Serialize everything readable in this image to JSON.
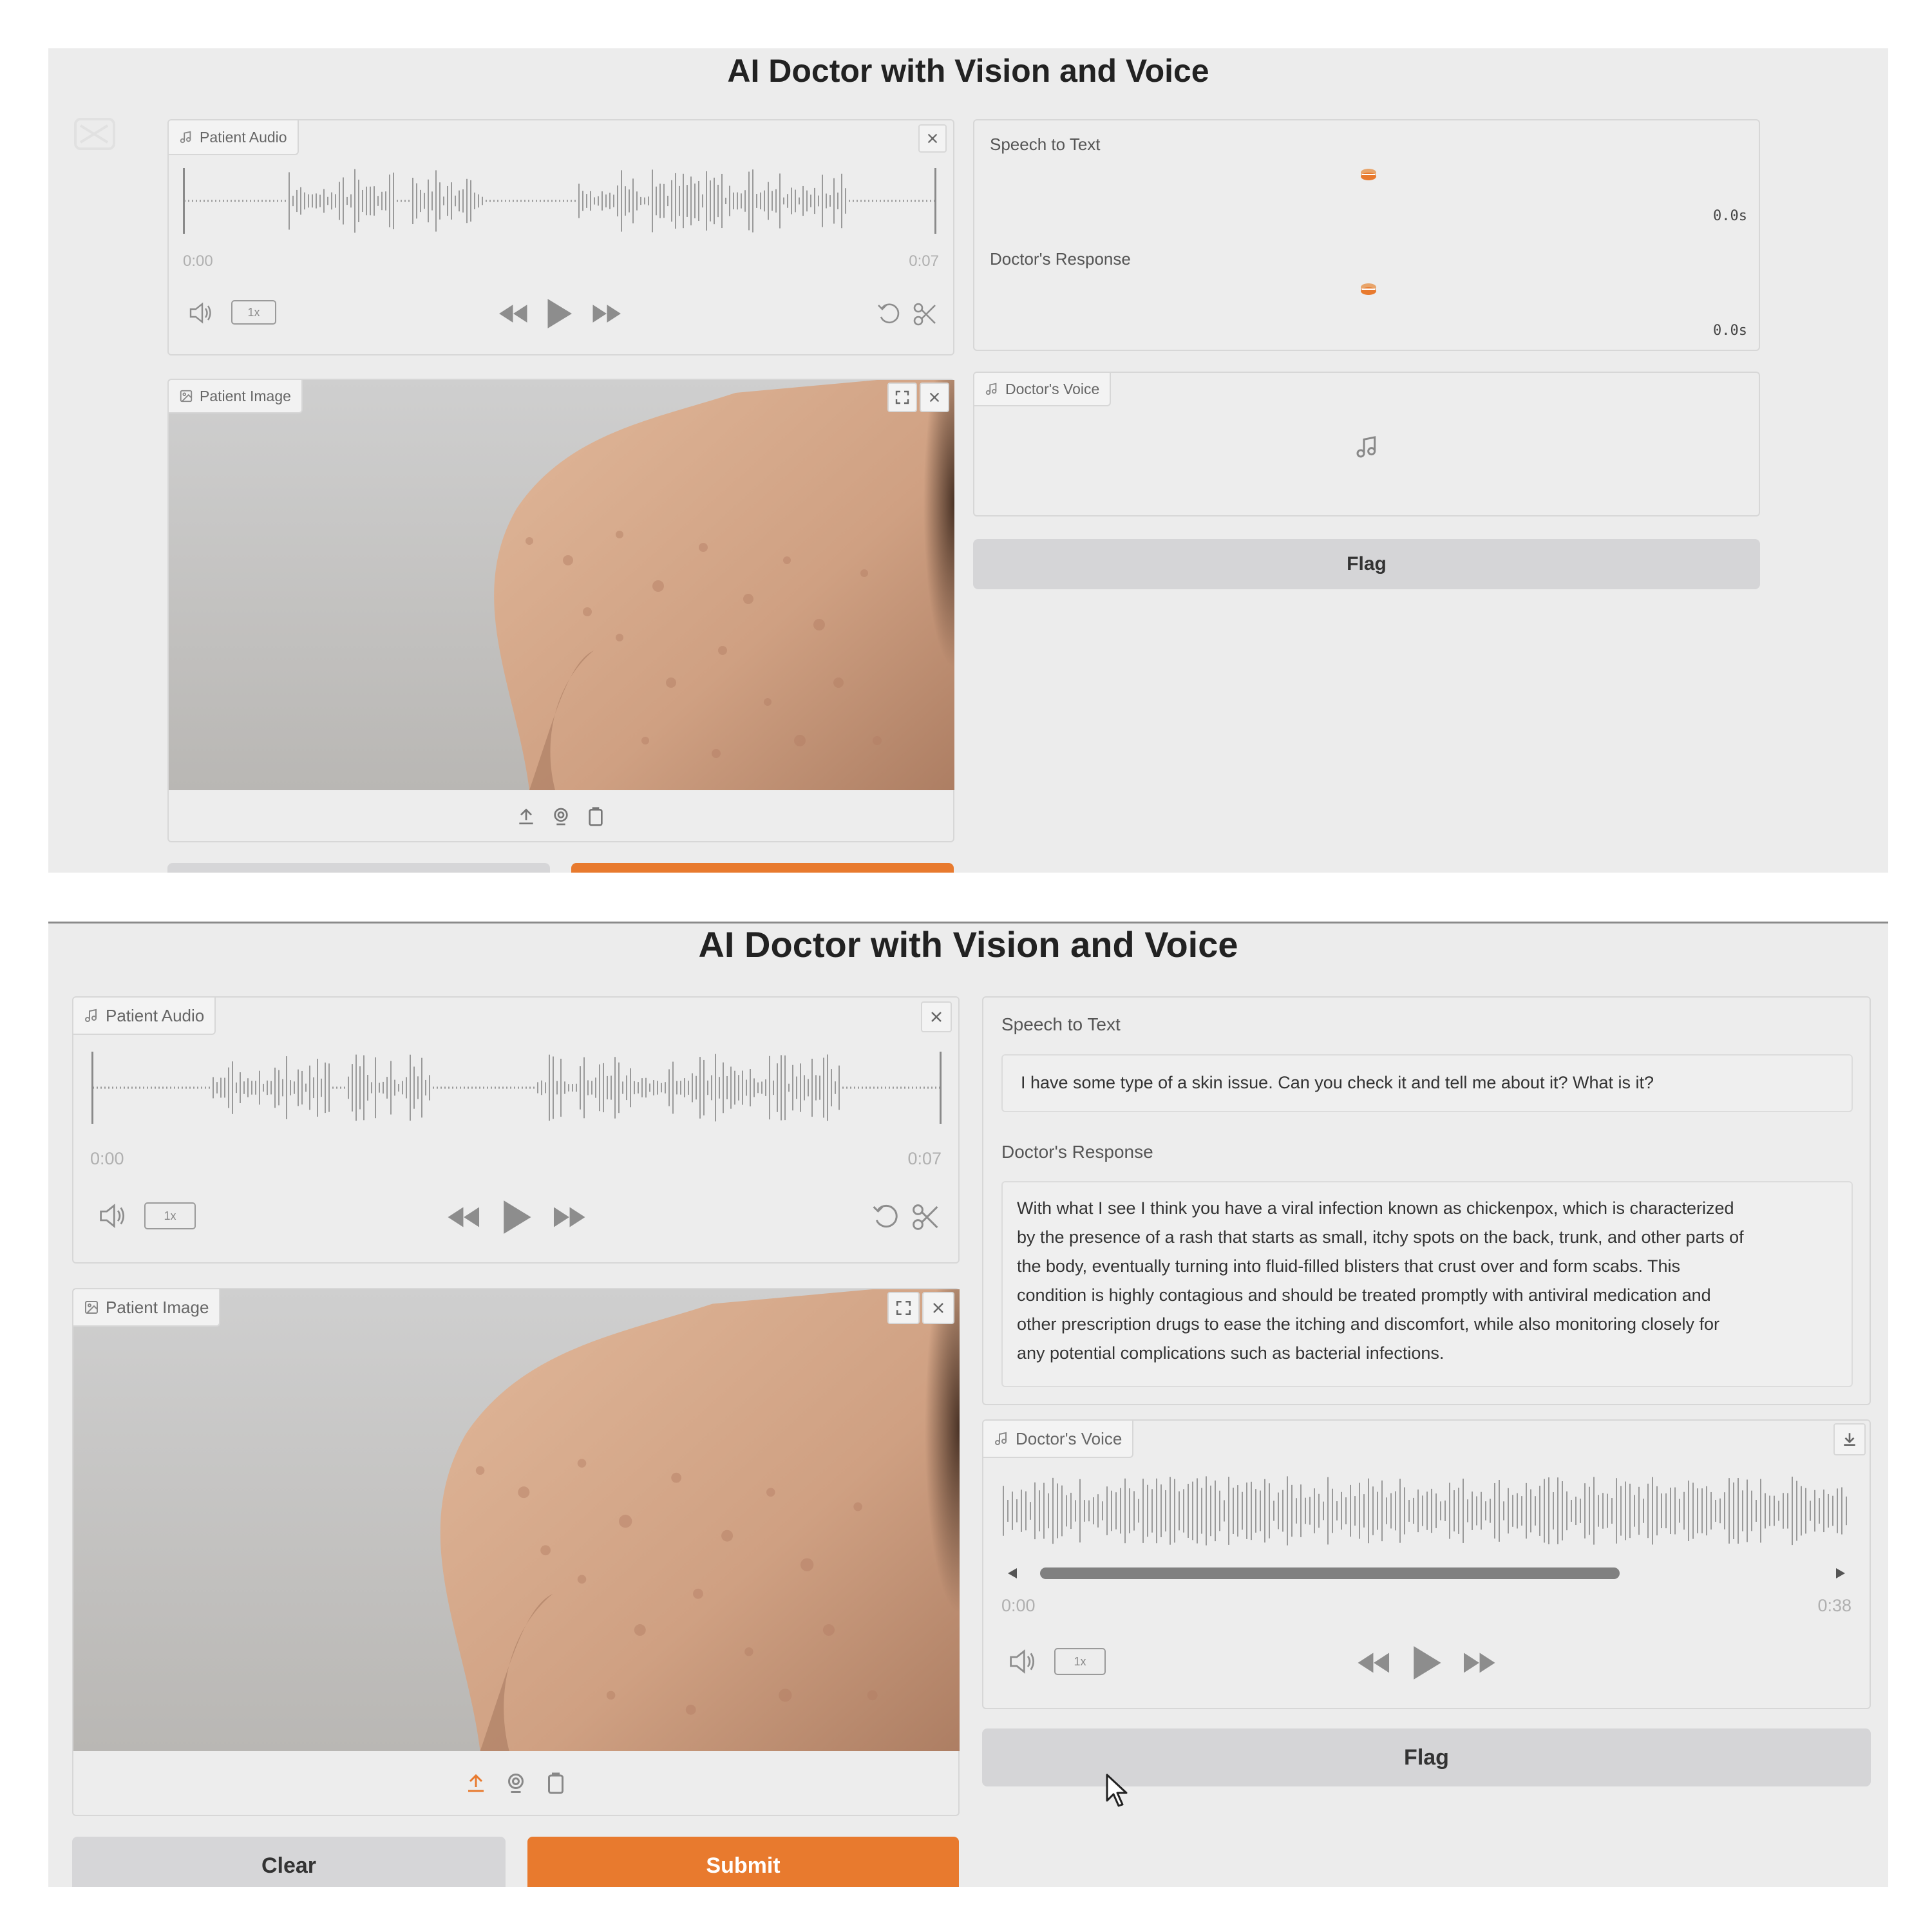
{
  "app_title": "AI Doctor with Vision and Voice",
  "top": {
    "patient_audio": {
      "label": "Patient Audio",
      "time_start": "0:00",
      "time_end": "0:07",
      "speed": "1x"
    },
    "patient_image": {
      "label": "Patient Image"
    },
    "speech_to_text": {
      "label": "Speech to Text",
      "timer": "0.0s"
    },
    "doctors_response": {
      "label": "Doctor's Response",
      "timer": "0.0s"
    },
    "doctors_voice": {
      "label": "Doctor's Voice"
    },
    "flag_label": "Flag"
  },
  "bottom": {
    "patient_audio": {
      "label": "Patient Audio",
      "time_start": "0:00",
      "time_end": "0:07",
      "speed": "1x"
    },
    "patient_image": {
      "label": "Patient Image"
    },
    "speech_to_text": {
      "label": "Speech to Text",
      "value": "I have some type of a skin issue. Can you check it and tell me about it? What is it?"
    },
    "doctors_response": {
      "label": "Doctor's Response",
      "lines": [
        "With what I see I think you have a viral infection known as chickenpox, which is characterized",
        "by the presence of a rash that starts as small, itchy spots on the back, trunk, and other parts of",
        "the body, eventually turning into fluid-filled blisters that crust over and form scabs. This",
        "condition is highly contagious and should be treated promptly with antiviral medication and",
        "other prescription drugs to ease the itching and discomfort, while also monitoring closely for",
        "any potential complications such as bacterial infections."
      ]
    },
    "doctors_voice": {
      "label": "Doctor's Voice",
      "time_start": "0:00",
      "time_end": "0:38",
      "speed": "1x"
    },
    "flag_label": "Flag",
    "clear_label": "Clear",
    "submit_label": "Submit"
  },
  "icons": {
    "audio": "music-note-icon",
    "image": "image-icon",
    "close": "close-icon",
    "fullscreen": "fullscreen-icon",
    "volume": "volume-icon",
    "rewind": "rewind-icon",
    "play": "play-icon",
    "forward": "fast-forward-icon",
    "undo": "undo-icon",
    "trim": "scissors-icon",
    "upload": "upload-icon",
    "webcam": "webcam-icon",
    "clipboard": "clipboard-icon",
    "download": "download-icon",
    "cursor": "mouse-cursor-icon",
    "loading": "loading-spinner-icon"
  },
  "colors": {
    "accent": "#e87a2e",
    "panel_bg": "#ececec",
    "button_gray": "#d6d6d8"
  }
}
